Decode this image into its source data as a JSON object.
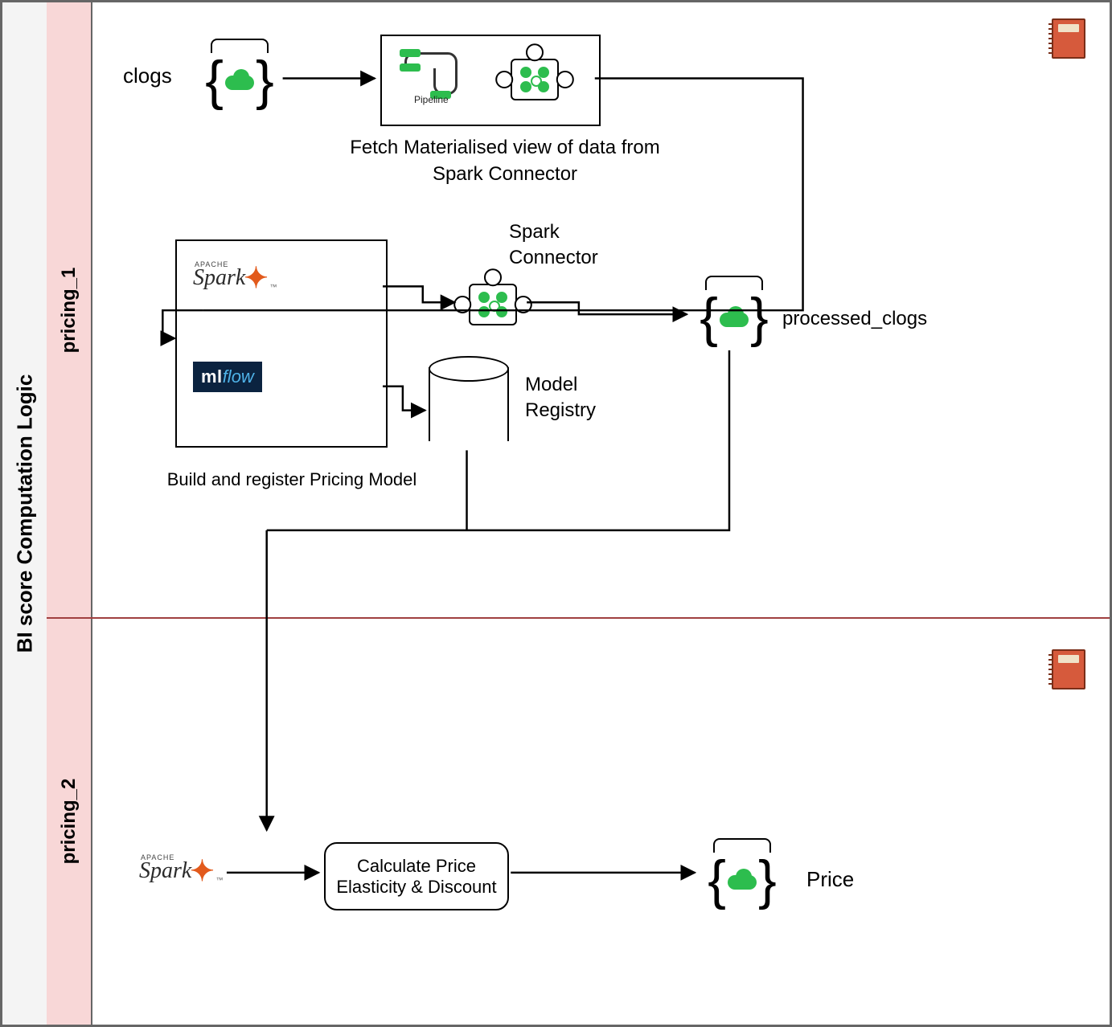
{
  "swimlane": {
    "main_label": "BI score Computation Logic",
    "lane1_label": "pricing_1",
    "lane2_label": "pricing_2"
  },
  "lane1": {
    "clogs_label": "clogs",
    "fetch_caption_line1": "Fetch Materialised view of data from",
    "fetch_caption_line2": "Spark Connector",
    "build_caption": "Build and register Pricing Model",
    "spark_text": "Spark",
    "spark_apache": "APACHE",
    "mlflow_ml": "ml",
    "mlflow_flow": "flow",
    "spark_connector_line1": "Spark",
    "spark_connector_line2": "Connector",
    "model_registry_line1": "Model",
    "model_registry_line2": "Registry",
    "processed_clogs_label": "processed_clogs",
    "pipeline_caption": "Pipeline"
  },
  "lane2": {
    "spark_text": "Spark",
    "spark_apache": "APACHE",
    "calc_line1": "Calculate Price",
    "calc_line2": "Elasticity & Discount",
    "price_label": "Price"
  }
}
